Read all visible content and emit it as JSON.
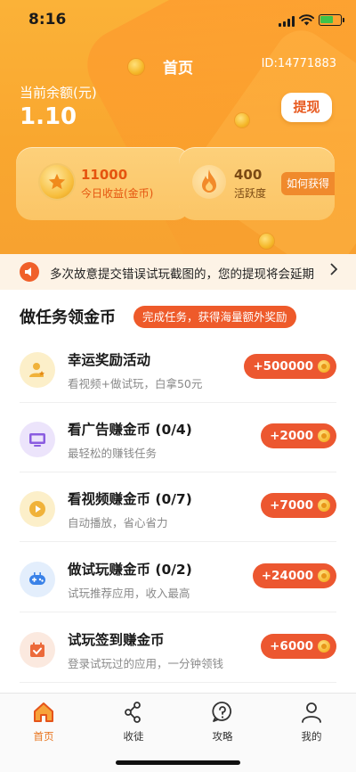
{
  "status_bar": {
    "time": "8:16"
  },
  "header": {
    "title": "首页",
    "user_id": "ID:14771883",
    "balance_label": "当前余额(元)",
    "balance_value": "1.10",
    "withdraw_label": "提现"
  },
  "stats": {
    "coins_value": "11000",
    "coins_label": "今日收益(金币)",
    "activity_value": "400",
    "activity_label": "活跃度",
    "how_label": "如何获得"
  },
  "notice": {
    "text": "多次故意提交错误试玩截图的，您的提现将会延期"
  },
  "tasks_section": {
    "title": "做任务领金币",
    "badge": "完成任务，获得海量额外奖励"
  },
  "tasks": [
    {
      "title": "幸运奖励活动",
      "desc": "看视频+做试玩，白拿50元",
      "reward": "+500000",
      "icon": "user-star-icon",
      "icon_bg": "#fcefc9"
    },
    {
      "title": "看广告赚金币 (0/4)",
      "desc": "最轻松的赚钱任务",
      "reward": "+2000",
      "icon": "monitor-icon",
      "icon_bg": "#ece4fb"
    },
    {
      "title": "看视频赚金币 (0/7)",
      "desc": "自动播放，省心省力",
      "reward": "+7000",
      "icon": "play-icon",
      "icon_bg": "#fcefc9"
    },
    {
      "title": "做试玩赚金币 (0/2)",
      "desc": "试玩推荐应用，收入最高",
      "reward": "+24000",
      "icon": "gamepad-icon",
      "icon_bg": "#e3eefc"
    },
    {
      "title": "试玩签到赚金币",
      "desc": "登录试玩过的应用，一分钟领钱",
      "reward": "+6000",
      "icon": "calendar-check-icon",
      "icon_bg": "#fbe9df"
    }
  ],
  "tabbar": [
    {
      "label": "首页",
      "icon": "home-icon",
      "active": true
    },
    {
      "label": "收徒",
      "icon": "share-icon",
      "active": false
    },
    {
      "label": "攻略",
      "icon": "help-icon",
      "active": false
    },
    {
      "label": "我的",
      "icon": "user-icon",
      "active": false
    }
  ],
  "colors": {
    "brand_orange": "#f9a72f",
    "accent_red": "#ec5730",
    "tab_active": "#e8751f"
  }
}
